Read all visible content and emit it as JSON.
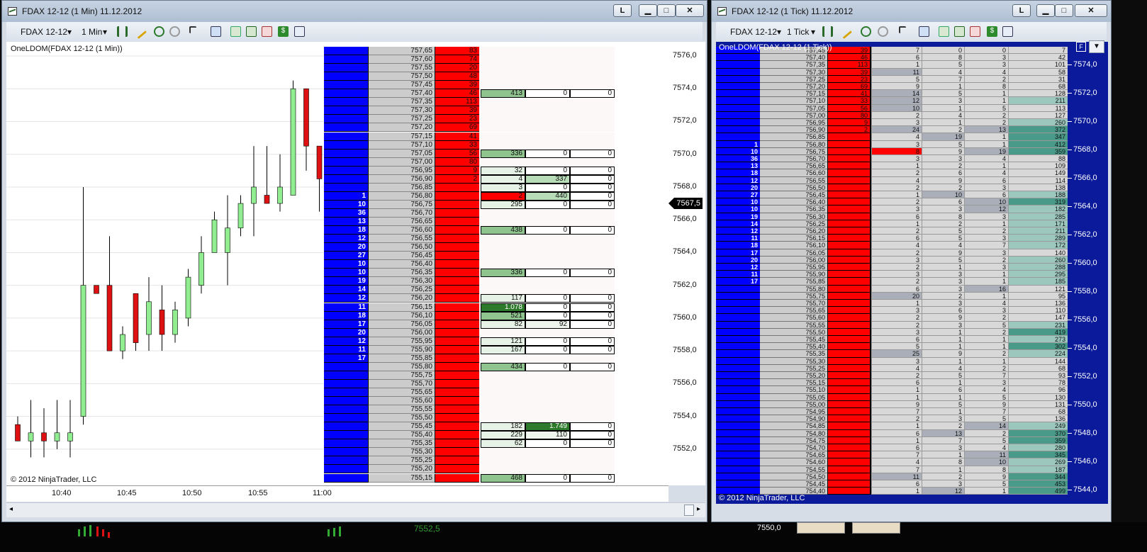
{
  "left_window": {
    "title": "FDAX 12-12 (1 Min)  11.12.2012",
    "title_buttons": {
      "link": "L",
      "minimize": "▁",
      "maximize": "□",
      "close": "✕"
    },
    "instrument": "FDAX 12-12",
    "interval": "1 Min",
    "indicator_label": "OneLDOM(FDAX 12-12 (1 Min))",
    "copyright": "© 2012 NinjaTrader, LLC",
    "last_price_tag": "7567,5",
    "y_ticks": [
      "7576,0",
      "7574,0",
      "7572,0",
      "7570,0",
      "7568,0",
      "7566,0",
      "7564,0",
      "7562,0",
      "7560,0",
      "7558,0",
      "7556,0",
      "7554,0",
      "7552,0"
    ],
    "x_ticks": [
      "10:40",
      "10:45",
      "10:50",
      "10:55",
      "11:00"
    ]
  },
  "right_window": {
    "title": "FDAX 12-12 (1 Tick)  11.12.2012",
    "title_buttons": {
      "link": "L",
      "minimize": "▁",
      "maximize": "□",
      "close": "✕"
    },
    "instrument": "FDAX 12-12",
    "interval": "1 Tick",
    "indicator_label": "OneLDOM(FDAX 12-12 (1 Tick))",
    "copyright": "© 2012 NinjaTrader, LLC",
    "y_ticks": [
      "7574,0",
      "7572,0",
      "7570,0",
      "7568,0",
      "7566,0",
      "7564,0",
      "7562,0",
      "7560,0",
      "7558,0",
      "7556,0",
      "7554,0",
      "7552,0",
      "7550,0",
      "7548,0",
      "7546,0",
      "7544,0"
    ],
    "corner_buttons": [
      "F",
      "▼"
    ]
  },
  "taskbar": {
    "price_text": "7552,5",
    "axis_text": "7550,0"
  },
  "colors": {
    "bid": "#0000ff",
    "ask": "#ff0000",
    "price_col": "#cccccc",
    "up_candle": "#90ee90",
    "down_candle": "#dd1111"
  },
  "left_dom": {
    "prices": [
      "757,65",
      "757,60",
      "757,55",
      "757,50",
      "757,45",
      "757,40",
      "757,35",
      "757,30",
      "757,25",
      "757,20",
      "757,15",
      "757,10",
      "757,05",
      "757,00",
      "756,95",
      "756,90",
      "756,85",
      "756,80",
      "756,75",
      "756,70",
      "756,65",
      "756,60",
      "756,55",
      "756,50",
      "756,45",
      "756,40",
      "756,35",
      "756,30",
      "756,25",
      "756,20",
      "756,15",
      "756,10",
      "756,05",
      "756,00",
      "755,95",
      "755,90",
      "755,85",
      "755,80",
      "755,75",
      "755,70",
      "755,65",
      "755,60",
      "755,55",
      "755,50",
      "755,45",
      "755,40",
      "755,35",
      "755,30",
      "755,25",
      "755,20",
      "755,15"
    ],
    "ask": [
      "83",
      "74",
      "20",
      "48",
      "39",
      "46",
      "113",
      "39",
      "23",
      "69",
      "41",
      "33",
      "56",
      "80",
      "9",
      "2",
      "",
      "",
      "",
      "",
      "",
      "",
      "",
      "",
      "",
      "",
      "",
      "",
      "",
      "",
      "",
      "",
      "",
      "",
      "",
      "",
      "",
      "",
      "",
      "",
      "",
      "",
      "",
      "",
      "",
      "",
      "",
      "",
      "",
      "",
      ""
    ],
    "bid": [
      "",
      "",
      "",
      "",
      "",
      "",
      "",
      "",
      "",
      "",
      "",
      "",
      "",
      "",
      "",
      "",
      "",
      "1",
      "10",
      "36",
      "13",
      "18",
      "12",
      "20",
      "27",
      "10",
      "10",
      "19",
      "14",
      "12",
      "11",
      "18",
      "17",
      "20",
      "12",
      "11",
      "17",
      "",
      "",
      "",
      "",
      "",
      "",
      "",
      "",
      "",
      "",
      "",
      "",
      "",
      ""
    ],
    "vol": [
      [
        "",
        "",
        ""
      ],
      [
        "",
        "",
        ""
      ],
      [
        "",
        "",
        ""
      ],
      [
        "",
        "",
        ""
      ],
      [
        "",
        "",
        ""
      ],
      [
        "413",
        "0",
        "0"
      ],
      [
        "",
        "",
        ""
      ],
      [
        "",
        "",
        ""
      ],
      [
        "",
        "",
        ""
      ],
      [
        "",
        "",
        ""
      ],
      [
        "",
        "",
        ""
      ],
      [
        "",
        "",
        ""
      ],
      [
        "336",
        "0",
        "0"
      ],
      [
        "",
        "",
        ""
      ],
      [
        "32",
        "0",
        "0"
      ],
      [
        "4",
        "337",
        "0"
      ],
      [
        "3",
        "0",
        "0"
      ],
      [
        "2",
        "440",
        "0"
      ],
      [
        "295",
        "0",
        "0"
      ],
      [
        "",
        "",
        ""
      ],
      [
        "",
        "",
        ""
      ],
      [
        "438",
        "0",
        "0"
      ],
      [
        "",
        "",
        ""
      ],
      [
        "",
        "",
        ""
      ],
      [
        "",
        "",
        ""
      ],
      [
        "",
        "",
        ""
      ],
      [
        "336",
        "0",
        "0"
      ],
      [
        "",
        "",
        ""
      ],
      [
        "",
        "",
        ""
      ],
      [
        "117",
        "0",
        "0"
      ],
      [
        "1.078",
        "0",
        "0"
      ],
      [
        "521",
        "0",
        "0"
      ],
      [
        "82",
        "92",
        "0"
      ],
      [
        "",
        "",
        ""
      ],
      [
        "121",
        "0",
        "0"
      ],
      [
        "167",
        "0",
        "0"
      ],
      [
        "",
        "",
        ""
      ],
      [
        "434",
        "0",
        "0"
      ],
      [
        "",
        "",
        ""
      ],
      [
        "",
        "",
        ""
      ],
      [
        "",
        "",
        ""
      ],
      [
        "",
        "",
        ""
      ],
      [
        "",
        "",
        ""
      ],
      [
        "",
        "",
        ""
      ],
      [
        "182",
        "1.749",
        "0"
      ],
      [
        "229",
        "110",
        "0"
      ],
      [
        "62",
        "0",
        "0"
      ],
      [
        "",
        "",
        ""
      ],
      [
        "",
        "",
        ""
      ],
      [
        "",
        "",
        ""
      ],
      [
        "468",
        "0",
        "0"
      ]
    ]
  },
  "right_dom": {
    "prices": [
      "757,45",
      "757,40",
      "757,35",
      "757,30",
      "757,25",
      "757,20",
      "757,15",
      "757,10",
      "757,05",
      "757,00",
      "756,95",
      "756,90",
      "756,85",
      "756,80",
      "756,75",
      "756,70",
      "756,65",
      "756,60",
      "756,55",
      "756,50",
      "756,45",
      "756,40",
      "756,35",
      "756,30",
      "756,25",
      "756,20",
      "756,15",
      "756,10",
      "756,05",
      "756,00",
      "755,95",
      "755,90",
      "755,85",
      "755,80",
      "755,75",
      "755,70",
      "755,65",
      "755,60",
      "755,55",
      "755,50",
      "755,45",
      "755,40",
      "755,35",
      "755,30",
      "755,25",
      "755,20",
      "755,15",
      "755,10",
      "755,05",
      "755,00",
      "754,95",
      "754,90",
      "754,85",
      "754,80",
      "754,75",
      "754,70",
      "754,65",
      "754,60",
      "754,55",
      "754,50",
      "754,45",
      "754,40"
    ],
    "ask": [
      "39",
      "46",
      "113",
      "39",
      "23",
      "69",
      "41",
      "33",
      "56",
      "80",
      "9",
      "2",
      "",
      "",
      "",
      "",
      "",
      "",
      "",
      "",
      "",
      "",
      "",
      "",
      "",
      "",
      "",
      "",
      "",
      "",
      "",
      "",
      "",
      "",
      "",
      "",
      "",
      "",
      "",
      "",
      "",
      "",
      "",
      "",
      "",
      "",
      "",
      "",
      "",
      "",
      "",
      "",
      "",
      "",
      "",
      "",
      "",
      "",
      "",
      "",
      "",
      ""
    ],
    "bid": [
      "",
      "",
      "",
      "",
      "",
      "",
      "",
      "",
      "",
      "",
      "",
      "",
      "",
      "1",
      "10",
      "36",
      "13",
      "18",
      "12",
      "20",
      "27",
      "10",
      "10",
      "19",
      "14",
      "12",
      "11",
      "18",
      "17",
      "20",
      "12",
      "11",
      "17",
      "",
      "",
      "",
      "",
      "",
      "",
      "",
      "",
      "",
      "",
      "",
      "",
      "",
      "",
      "",
      "",
      "",
      "",
      "",
      "",
      "",
      "",
      "",
      "",
      "",
      "",
      "",
      "",
      ""
    ],
    "c1": [
      "7",
      "6",
      "1",
      "11",
      "5",
      "9",
      "14",
      "12",
      "10",
      "2",
      "3",
      "24",
      "4",
      "3",
      "8",
      "3",
      "1",
      "2",
      "4",
      "2",
      "1",
      "2",
      "3",
      "6",
      "1",
      "2",
      "6",
      "4",
      "2",
      "3",
      "2",
      "3",
      "2",
      "6",
      "20",
      "1",
      "3",
      "2",
      "2",
      "3",
      "6",
      "5",
      "25",
      "3",
      "4",
      "2",
      "6",
      "1",
      "1",
      "9",
      "7",
      "2",
      "1",
      "6",
      "1",
      "6",
      "7",
      "4",
      "7",
      "11",
      "6",
      "1"
    ],
    "c2": [
      "0",
      "8",
      "5",
      "4",
      "7",
      "1",
      "5",
      "3",
      "1",
      "4",
      "1",
      "2",
      "19",
      "5",
      "9",
      "3",
      "2",
      "6",
      "9",
      "2",
      "10",
      "6",
      "3",
      "8",
      "2",
      "5",
      "5",
      "4",
      "9",
      "5",
      "1",
      "3",
      "3",
      "3",
      "2",
      "3",
      "6",
      "9",
      "3",
      "1",
      "1",
      "1",
      "9",
      "1",
      "4",
      "5",
      "1",
      "6",
      "1",
      "5",
      "1",
      "3",
      "2",
      "13",
      "7",
      "3",
      "1",
      "8",
      "1",
      "2",
      "3",
      "12"
    ],
    "c3": [
      "0",
      "3",
      "3",
      "4",
      "2",
      "8",
      "1",
      "1",
      "5",
      "2",
      "2",
      "13",
      "1",
      "1",
      "19",
      "4",
      "1",
      "4",
      "6",
      "3",
      "6",
      "10",
      "12",
      "3",
      "1",
      "2",
      "3",
      "7",
      "3",
      "2",
      "3",
      "1",
      "1",
      "16",
      "1",
      "4",
      "3",
      "2",
      "5",
      "2",
      "1",
      "1",
      "2",
      "1",
      "2",
      "7",
      "3",
      "4",
      "5",
      "9",
      "7",
      "5",
      "14",
      "2",
      "5",
      "4",
      "11",
      "10",
      "8",
      "9",
      "5",
      "1"
    ],
    "c4": [
      "7",
      "42",
      "101",
      "58",
      "31",
      "68",
      "128",
      "211",
      "113",
      "127",
      "260",
      "372",
      "347",
      "412",
      "359",
      "88",
      "109",
      "149",
      "114",
      "138",
      "188",
      "319",
      "182",
      "285",
      "171",
      "211",
      "289",
      "172",
      "140",
      "260",
      "288",
      "295",
      "185",
      "121",
      "95",
      "136",
      "110",
      "147",
      "231",
      "419",
      "273",
      "302",
      "224",
      "144",
      "68",
      "93",
      "78",
      "96",
      "130",
      "131",
      "68",
      "136",
      "249",
      "370",
      "359",
      "280",
      "345",
      "269",
      "187",
      "344",
      "453",
      "499"
    ]
  },
  "chart_data": {
    "type": "candlestick",
    "y_range": [
      7551.0,
      7576.0
    ],
    "x_labels": [
      "10:40",
      "10:45",
      "10:50",
      "10:55",
      "11:00"
    ],
    "candles": [
      {
        "o": 7553.5,
        "h": 7554.0,
        "l": 7552.5,
        "c": 7552.5
      },
      {
        "o": 7552.5,
        "h": 7555.0,
        "l": 7551.5,
        "c": 7553.0
      },
      {
        "o": 7553.0,
        "h": 7554.5,
        "l": 7551.5,
        "c": 7552.5
      },
      {
        "o": 7552.5,
        "h": 7555.0,
        "l": 7552.0,
        "c": 7553.0
      },
      {
        "o": 7552.5,
        "h": 7555.0,
        "l": 7551.5,
        "c": 7553.0
      },
      {
        "o": 7554.0,
        "h": 7568.0,
        "l": 7553.5,
        "c": 7562.0
      },
      {
        "o": 7562.0,
        "h": 7562.0,
        "l": 7561.5,
        "c": 7561.5
      },
      {
        "o": 7562.0,
        "h": 7565.0,
        "l": 7558.0,
        "c": 7558.0
      },
      {
        "o": 7558.0,
        "h": 7559.5,
        "l": 7557.5,
        "c": 7559.0
      },
      {
        "o": 7561.5,
        "h": 7561.5,
        "l": 7558.0,
        "c": 7558.5
      },
      {
        "o": 7559.0,
        "h": 7562.5,
        "l": 7558.0,
        "c": 7561.0
      },
      {
        "o": 7560.5,
        "h": 7562.0,
        "l": 7558.0,
        "c": 7559.0
      },
      {
        "o": 7559.0,
        "h": 7561.0,
        "l": 7558.5,
        "c": 7560.5
      },
      {
        "o": 7560.0,
        "h": 7563.0,
        "l": 7559.5,
        "c": 7562.5
      },
      {
        "o": 7562.0,
        "h": 7565.0,
        "l": 7561.5,
        "c": 7564.0
      },
      {
        "o": 7564.0,
        "h": 7566.5,
        "l": 7564.0,
        "c": 7566.0
      },
      {
        "o": 7564.0,
        "h": 7567.5,
        "l": 7562.0,
        "c": 7565.5
      },
      {
        "o": 7565.5,
        "h": 7567.5,
        "l": 7565.0,
        "c": 7567.0
      },
      {
        "o": 7567.0,
        "h": 7570.5,
        "l": 7565.0,
        "c": 7568.0
      },
      {
        "o": 7567.5,
        "h": 7570.5,
        "l": 7567.0,
        "c": 7567.0
      },
      {
        "o": 7567.0,
        "h": 7570.0,
        "l": 7566.5,
        "c": 7568.0
      },
      {
        "o": 7567.5,
        "h": 7574.5,
        "l": 7567.5,
        "c": 7574.0
      },
      {
        "o": 7574.0,
        "h": 7574.0,
        "l": 7569.0,
        "c": 7570.5
      },
      {
        "o": 7570.5,
        "h": 7570.5,
        "l": 7566.5,
        "c": 7568.5
      },
      {
        "o": 7568.5,
        "h": 7569.5,
        "l": 7567.5,
        "c": 7568.0
      },
      {
        "o": 7568.5,
        "h": 7569.0,
        "l": 7567.5,
        "c": 7568.5
      },
      {
        "o": 7568.0,
        "h": 7569.0,
        "l": 7566.5,
        "c": 7567.5
      },
      {
        "o": 7568.5,
        "h": 7569.0,
        "l": 7567.0,
        "c": 7568.0
      },
      {
        "o": 7567.5,
        "h": 7569.0,
        "l": 7566.5,
        "c": 7567.5
      },
      {
        "o": 7567.5,
        "h": 7568.5,
        "l": 7566.0,
        "c": 7566.5
      },
      {
        "o": 7567.5,
        "h": 7568.5,
        "l": 7566.5,
        "c": 7567.5
      }
    ]
  }
}
